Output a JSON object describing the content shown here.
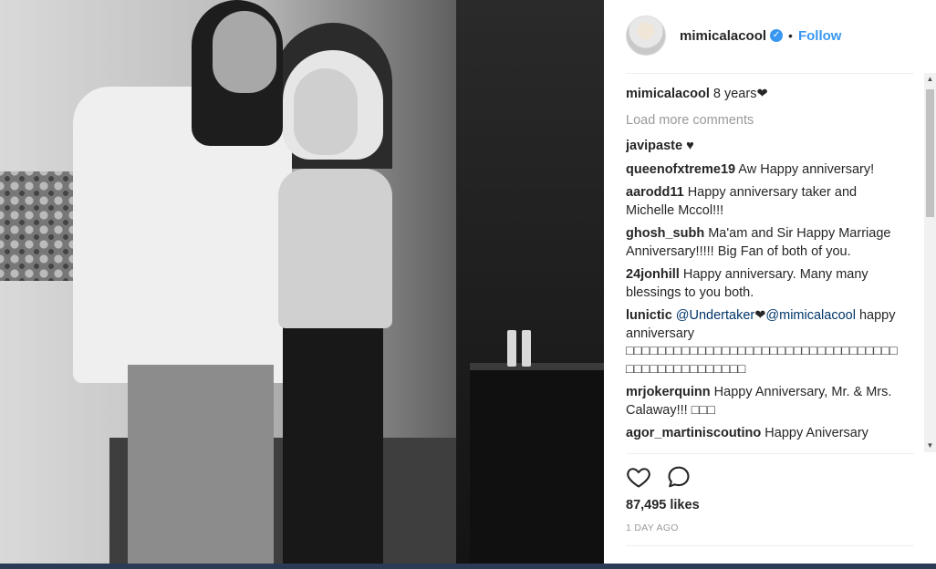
{
  "post": {
    "username": "mimicalacool",
    "verified_icon": "check-icon",
    "separator": "•",
    "follow_label": "Follow"
  },
  "caption": {
    "username": "mimicalacool",
    "text": " 8 years❤"
  },
  "load_more_label": "Load more comments",
  "comments": [
    {
      "user": "javipaste",
      "text": " ♥"
    },
    {
      "user": "queenofxtreme19",
      "text": " Aw Happy anniversary!"
    },
    {
      "user": "aarodd11",
      "text": " Happy anniversary taker and Michelle Mccol!!!"
    },
    {
      "user": "ghosh_subh",
      "text": " Ma'am and Sir Happy Marriage Anniversary!!!!! Big Fan of both of you."
    },
    {
      "user": "24jonhill",
      "text": " Happy anniversary. Many many blessings to you both."
    },
    {
      "user": "lunictic",
      "mention1": "@Undertaker",
      "mid": "❤",
      "mention2": "@mimicalacool",
      "text": " happy anniversary □□□□□□□□□□□□□□□□□□□□□□□□□□□□□□□□□□□□□□□□□□□□□□□□□"
    },
    {
      "user": "mrjokerquinn",
      "text": " Happy Anniversary, Mr. & Mrs. Calaway!!! □□□"
    },
    {
      "user": "agor_martiniscoutino",
      "text": " Happy Aniversary"
    }
  ],
  "likes": "87,495 likes",
  "timestamp": "1 DAY AGO",
  "colors": {
    "link_blue": "#3897f0",
    "text": "#262626",
    "muted": "#999999"
  }
}
